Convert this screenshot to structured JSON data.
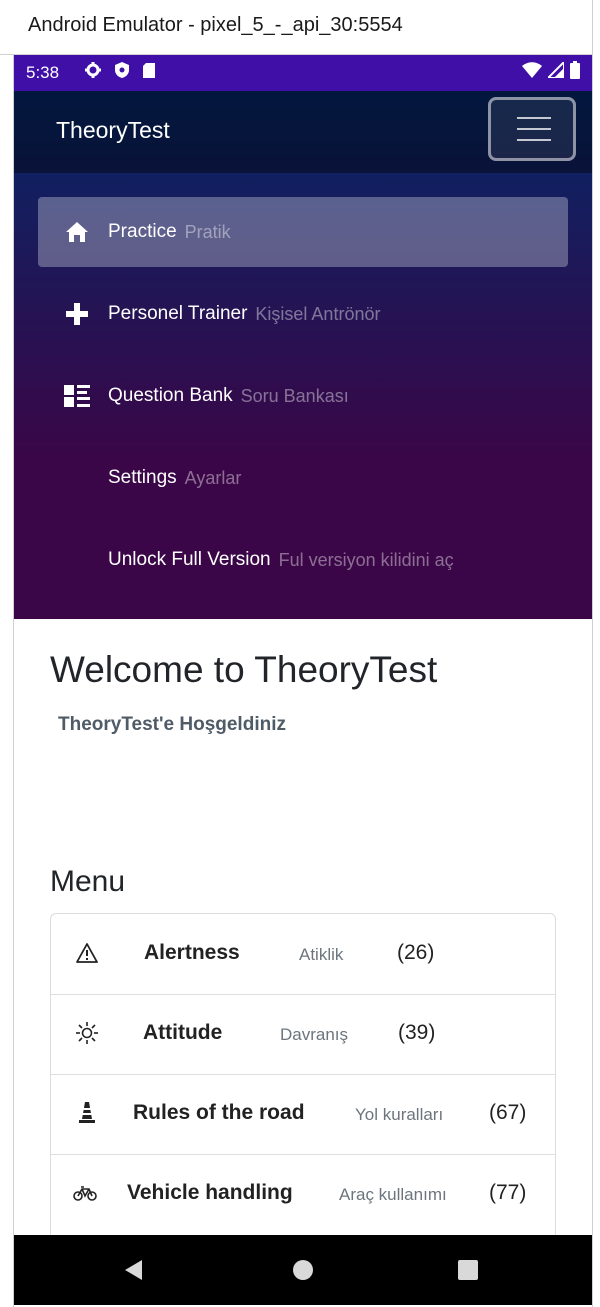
{
  "window": {
    "title": "Android Emulator - pixel_5_-_api_30:5554"
  },
  "status_bar": {
    "time": "5:38",
    "background": "#3f0fa8"
  },
  "app": {
    "brand": "TheoryTest",
    "nav": [
      {
        "label": "Practice",
        "sub": "Pratik",
        "icon": "home-icon",
        "active": true
      },
      {
        "label": "Personel Trainer",
        "sub": "Kişisel Antrönör",
        "icon": "plus-icon",
        "active": false
      },
      {
        "label": "Question Bank",
        "sub": "Soru Bankası",
        "icon": "list-icon",
        "active": false
      },
      {
        "label": "Settings",
        "sub": "Ayarlar",
        "icon": "",
        "active": false
      },
      {
        "label": "Unlock Full Version",
        "sub": "Ful versiyon kilidini aç",
        "icon": "",
        "active": false
      }
    ]
  },
  "main": {
    "title": "Welcome to TheoryTest",
    "subtitle": "TheoryTest'e Hoşgeldiniz",
    "menu_heading": "Menu",
    "items": [
      {
        "title": "Alertness",
        "sub": "Atiklik",
        "count": "(26)",
        "icon": "warning-icon"
      },
      {
        "title": "Attitude",
        "sub": "Davranış",
        "count": "(39)",
        "icon": "sun-icon"
      },
      {
        "title": "Rules of the road",
        "sub": "Yol kuralları",
        "count": "(67)",
        "icon": "traffic-cone-icon"
      },
      {
        "title": "Vehicle handling",
        "sub": "Araç kullanımı",
        "count": "(77)",
        "icon": "bicycle-icon"
      }
    ]
  },
  "system_nav": {
    "back_icon": "back-triangle-icon",
    "home_icon": "home-circle-icon",
    "recents_icon": "recents-square-icon"
  }
}
